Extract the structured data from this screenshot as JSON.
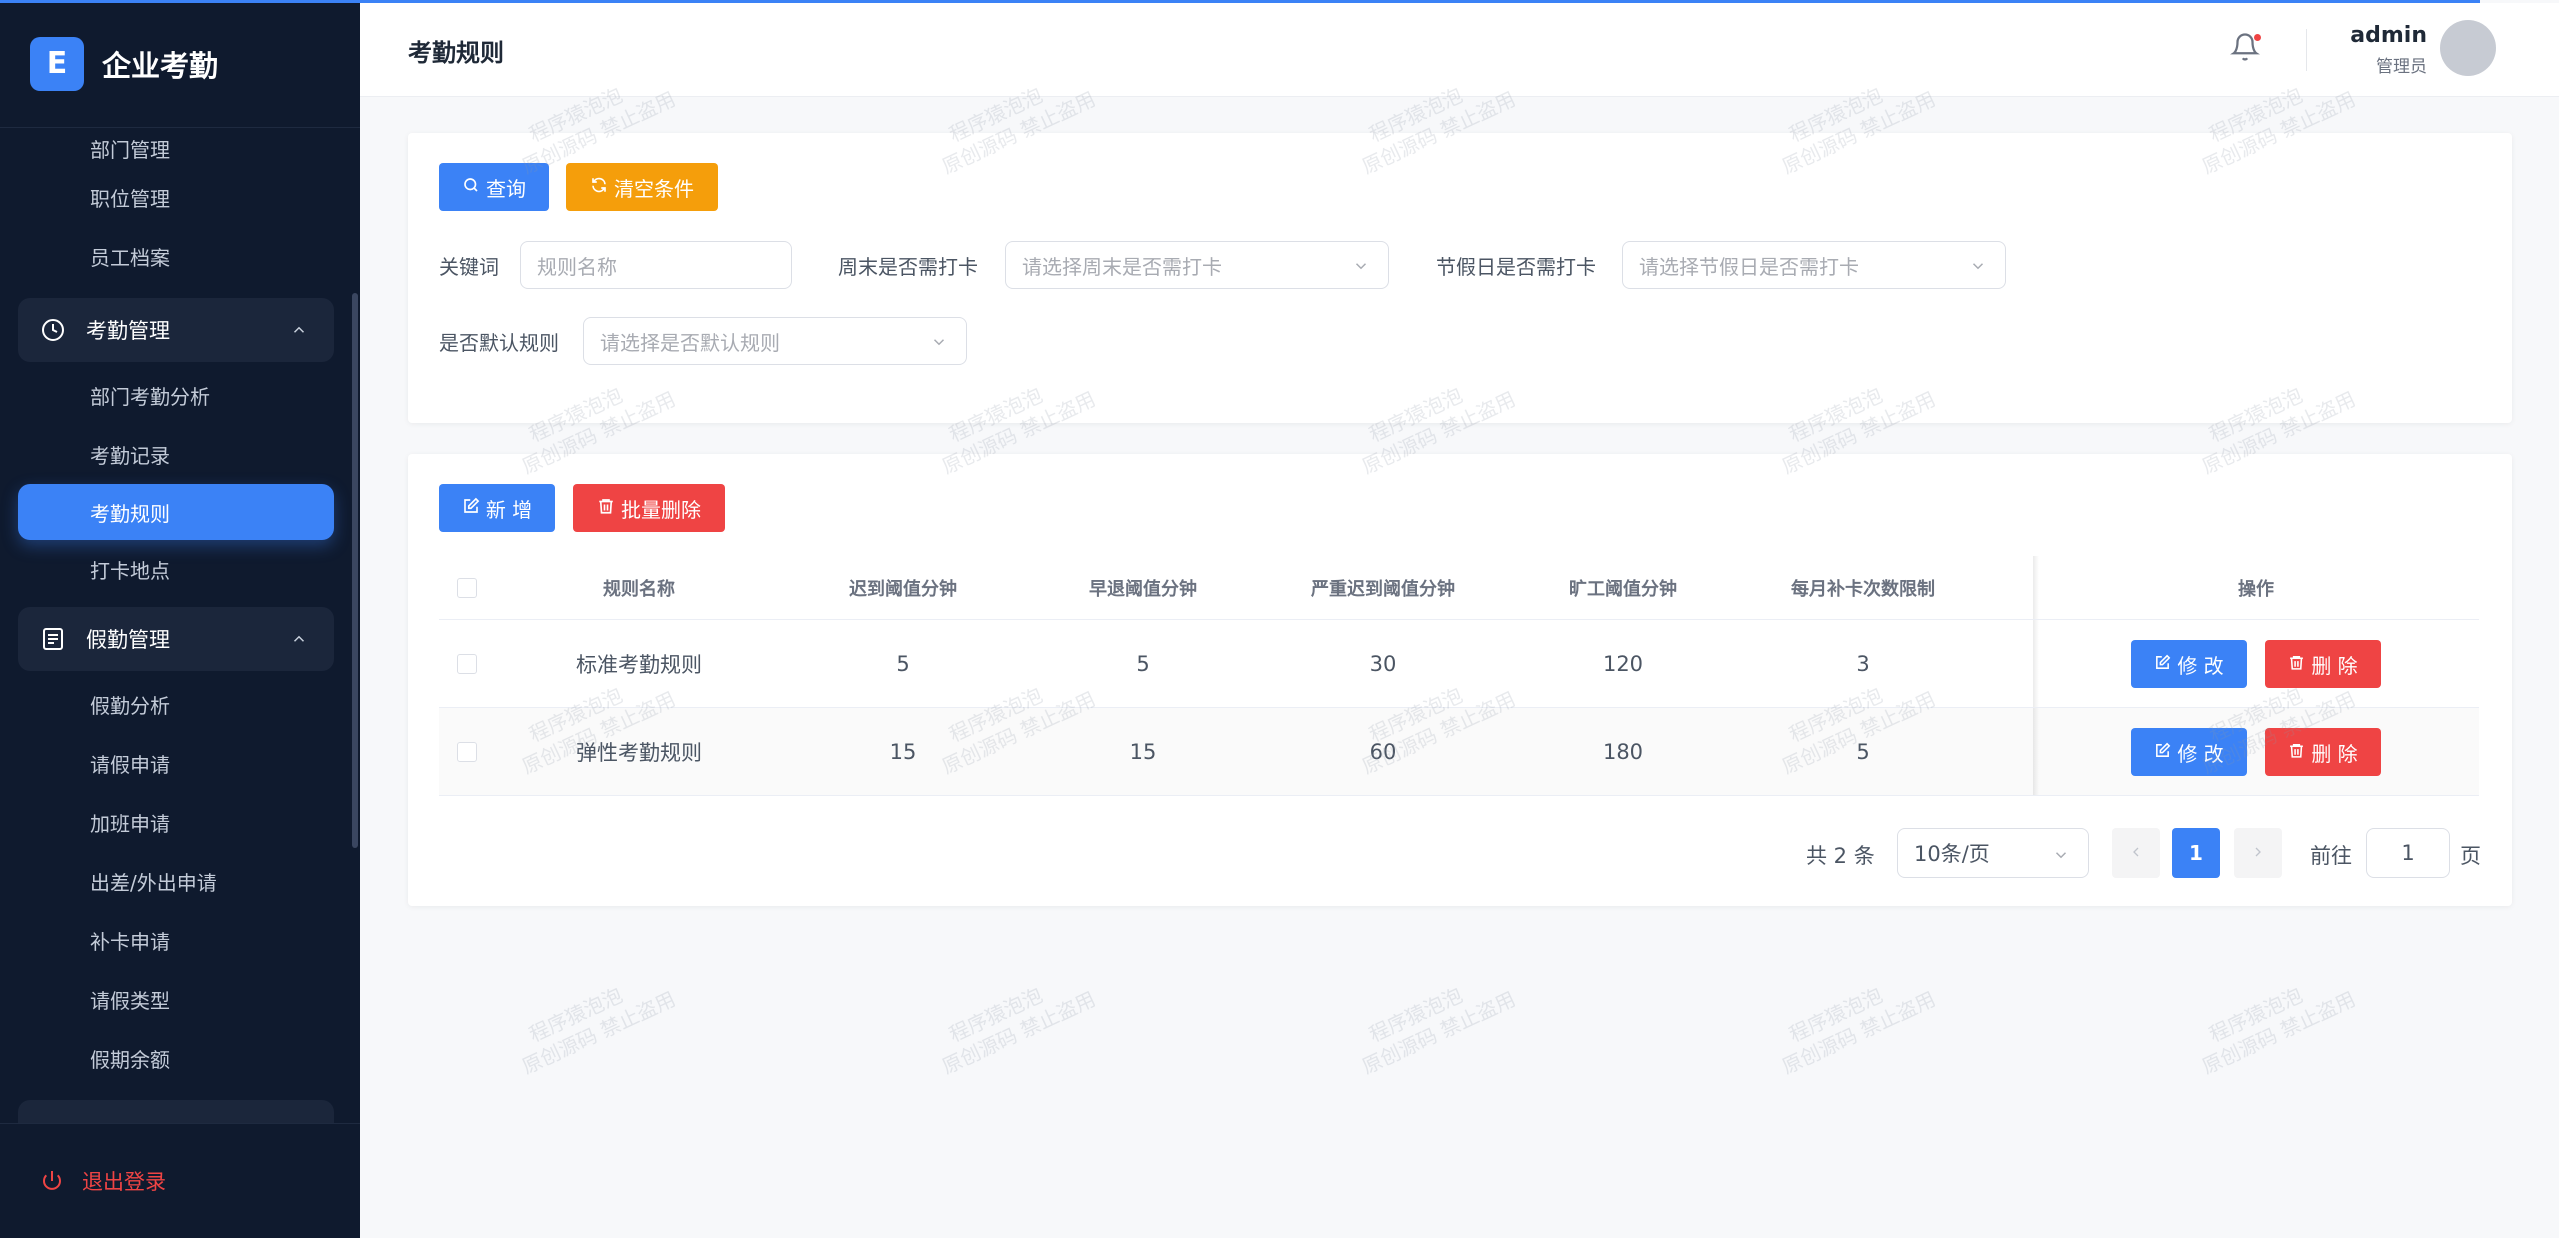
{
  "app": {
    "logo_letter": "E",
    "title": "企业考勤"
  },
  "sidebar": {
    "top_items": [
      "部门管理",
      "职位管理",
      "员工档案"
    ],
    "group_attendance": "考勤管理",
    "attendance_items": [
      "部门考勤分析",
      "考勤记录",
      "考勤规则",
      "打卡地点"
    ],
    "group_leave": "假勤管理",
    "leave_items": [
      "假勤分析",
      "请假申请",
      "加班申请",
      "出差/外出申请",
      "补卡申请",
      "请假类型",
      "假期余额"
    ],
    "logout": "退出登录"
  },
  "header": {
    "title": "考勤规则",
    "user_name": "admin",
    "user_role": "管理员"
  },
  "search": {
    "query_btn": "查询",
    "clear_btn": "清空条件",
    "keyword_label": "关键词",
    "keyword_placeholder": "规则名称",
    "weekend_label": "周末是否需打卡",
    "weekend_placeholder": "请选择周末是否需打卡",
    "holiday_label": "节假日是否需打卡",
    "holiday_placeholder": "请选择节假日是否需打卡",
    "default_label": "是否默认规则",
    "default_placeholder": "请选择是否默认规则"
  },
  "toolbar": {
    "add_btn": "新 增",
    "batch_delete_btn": "批量删除"
  },
  "table": {
    "columns": [
      "规则名称",
      "迟到阈值分钟",
      "早退阈值分钟",
      "严重迟到阈值分钟",
      "旷工阈值分钟",
      "每月补卡次数限制",
      "操作"
    ],
    "rows": [
      {
        "name": "标准考勤规则",
        "late": "5",
        "early": "5",
        "serious": "30",
        "absent": "120",
        "limit": "3"
      },
      {
        "name": "弹性考勤规则",
        "late": "15",
        "early": "15",
        "serious": "60",
        "absent": "180",
        "limit": "5"
      }
    ],
    "edit_btn": "修 改",
    "delete_btn": "删 除"
  },
  "pagination": {
    "total": "共 2 条",
    "page_size": "10条/页",
    "current": "1",
    "goto_label": "前往",
    "goto_value": "1",
    "page_suffix": "页"
  },
  "watermark": {
    "line1": "程序猿泡泡",
    "line2": "原创源码 禁止盗用"
  },
  "colors": {
    "primary": "#3b82f6",
    "warning": "#f59e0b",
    "danger": "#ef4444",
    "sidebar_bg": "#0f1a2e"
  }
}
